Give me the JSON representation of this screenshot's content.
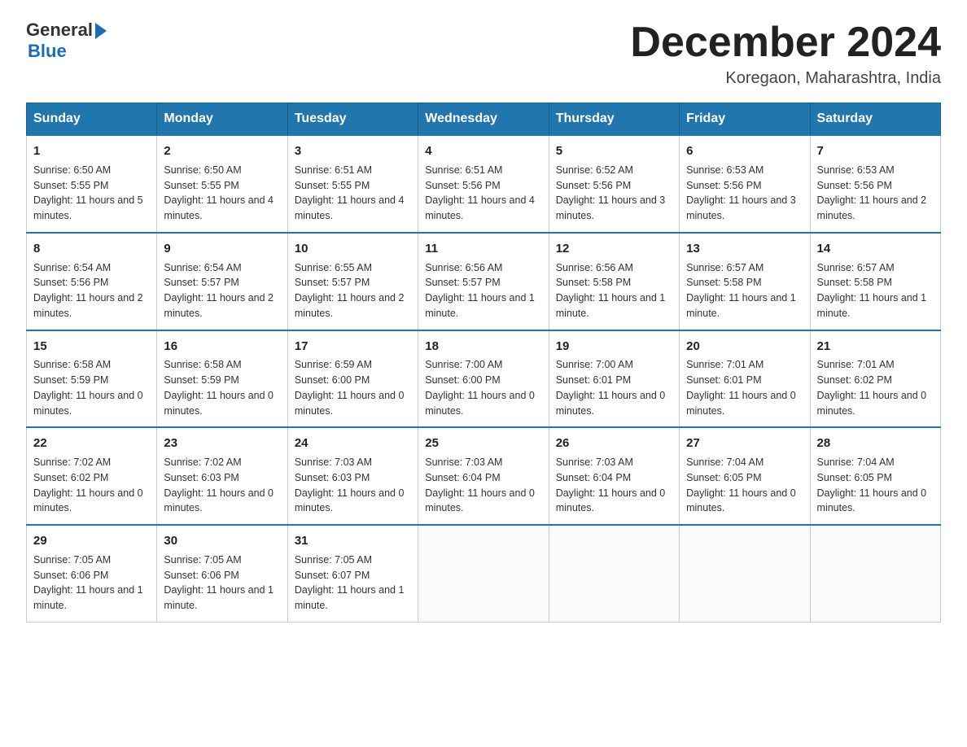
{
  "header": {
    "logo_general": "General",
    "logo_blue": "Blue",
    "month_title": "December 2024",
    "location": "Koregaon, Maharashtra, India"
  },
  "days_of_week": [
    "Sunday",
    "Monday",
    "Tuesday",
    "Wednesday",
    "Thursday",
    "Friday",
    "Saturday"
  ],
  "weeks": [
    [
      {
        "day": "1",
        "sunrise": "6:50 AM",
        "sunset": "5:55 PM",
        "daylight": "11 hours and 5 minutes."
      },
      {
        "day": "2",
        "sunrise": "6:50 AM",
        "sunset": "5:55 PM",
        "daylight": "11 hours and 4 minutes."
      },
      {
        "day": "3",
        "sunrise": "6:51 AM",
        "sunset": "5:55 PM",
        "daylight": "11 hours and 4 minutes."
      },
      {
        "day": "4",
        "sunrise": "6:51 AM",
        "sunset": "5:56 PM",
        "daylight": "11 hours and 4 minutes."
      },
      {
        "day": "5",
        "sunrise": "6:52 AM",
        "sunset": "5:56 PM",
        "daylight": "11 hours and 3 minutes."
      },
      {
        "day": "6",
        "sunrise": "6:53 AM",
        "sunset": "5:56 PM",
        "daylight": "11 hours and 3 minutes."
      },
      {
        "day": "7",
        "sunrise": "6:53 AM",
        "sunset": "5:56 PM",
        "daylight": "11 hours and 2 minutes."
      }
    ],
    [
      {
        "day": "8",
        "sunrise": "6:54 AM",
        "sunset": "5:56 PM",
        "daylight": "11 hours and 2 minutes."
      },
      {
        "day": "9",
        "sunrise": "6:54 AM",
        "sunset": "5:57 PM",
        "daylight": "11 hours and 2 minutes."
      },
      {
        "day": "10",
        "sunrise": "6:55 AM",
        "sunset": "5:57 PM",
        "daylight": "11 hours and 2 minutes."
      },
      {
        "day": "11",
        "sunrise": "6:56 AM",
        "sunset": "5:57 PM",
        "daylight": "11 hours and 1 minute."
      },
      {
        "day": "12",
        "sunrise": "6:56 AM",
        "sunset": "5:58 PM",
        "daylight": "11 hours and 1 minute."
      },
      {
        "day": "13",
        "sunrise": "6:57 AM",
        "sunset": "5:58 PM",
        "daylight": "11 hours and 1 minute."
      },
      {
        "day": "14",
        "sunrise": "6:57 AM",
        "sunset": "5:58 PM",
        "daylight": "11 hours and 1 minute."
      }
    ],
    [
      {
        "day": "15",
        "sunrise": "6:58 AM",
        "sunset": "5:59 PM",
        "daylight": "11 hours and 0 minutes."
      },
      {
        "day": "16",
        "sunrise": "6:58 AM",
        "sunset": "5:59 PM",
        "daylight": "11 hours and 0 minutes."
      },
      {
        "day": "17",
        "sunrise": "6:59 AM",
        "sunset": "6:00 PM",
        "daylight": "11 hours and 0 minutes."
      },
      {
        "day": "18",
        "sunrise": "7:00 AM",
        "sunset": "6:00 PM",
        "daylight": "11 hours and 0 minutes."
      },
      {
        "day": "19",
        "sunrise": "7:00 AM",
        "sunset": "6:01 PM",
        "daylight": "11 hours and 0 minutes."
      },
      {
        "day": "20",
        "sunrise": "7:01 AM",
        "sunset": "6:01 PM",
        "daylight": "11 hours and 0 minutes."
      },
      {
        "day": "21",
        "sunrise": "7:01 AM",
        "sunset": "6:02 PM",
        "daylight": "11 hours and 0 minutes."
      }
    ],
    [
      {
        "day": "22",
        "sunrise": "7:02 AM",
        "sunset": "6:02 PM",
        "daylight": "11 hours and 0 minutes."
      },
      {
        "day": "23",
        "sunrise": "7:02 AM",
        "sunset": "6:03 PM",
        "daylight": "11 hours and 0 minutes."
      },
      {
        "day": "24",
        "sunrise": "7:03 AM",
        "sunset": "6:03 PM",
        "daylight": "11 hours and 0 minutes."
      },
      {
        "day": "25",
        "sunrise": "7:03 AM",
        "sunset": "6:04 PM",
        "daylight": "11 hours and 0 minutes."
      },
      {
        "day": "26",
        "sunrise": "7:03 AM",
        "sunset": "6:04 PM",
        "daylight": "11 hours and 0 minutes."
      },
      {
        "day": "27",
        "sunrise": "7:04 AM",
        "sunset": "6:05 PM",
        "daylight": "11 hours and 0 minutes."
      },
      {
        "day": "28",
        "sunrise": "7:04 AM",
        "sunset": "6:05 PM",
        "daylight": "11 hours and 0 minutes."
      }
    ],
    [
      {
        "day": "29",
        "sunrise": "7:05 AM",
        "sunset": "6:06 PM",
        "daylight": "11 hours and 1 minute."
      },
      {
        "day": "30",
        "sunrise": "7:05 AM",
        "sunset": "6:06 PM",
        "daylight": "11 hours and 1 minute."
      },
      {
        "day": "31",
        "sunrise": "7:05 AM",
        "sunset": "6:07 PM",
        "daylight": "11 hours and 1 minute."
      },
      null,
      null,
      null,
      null
    ]
  ]
}
